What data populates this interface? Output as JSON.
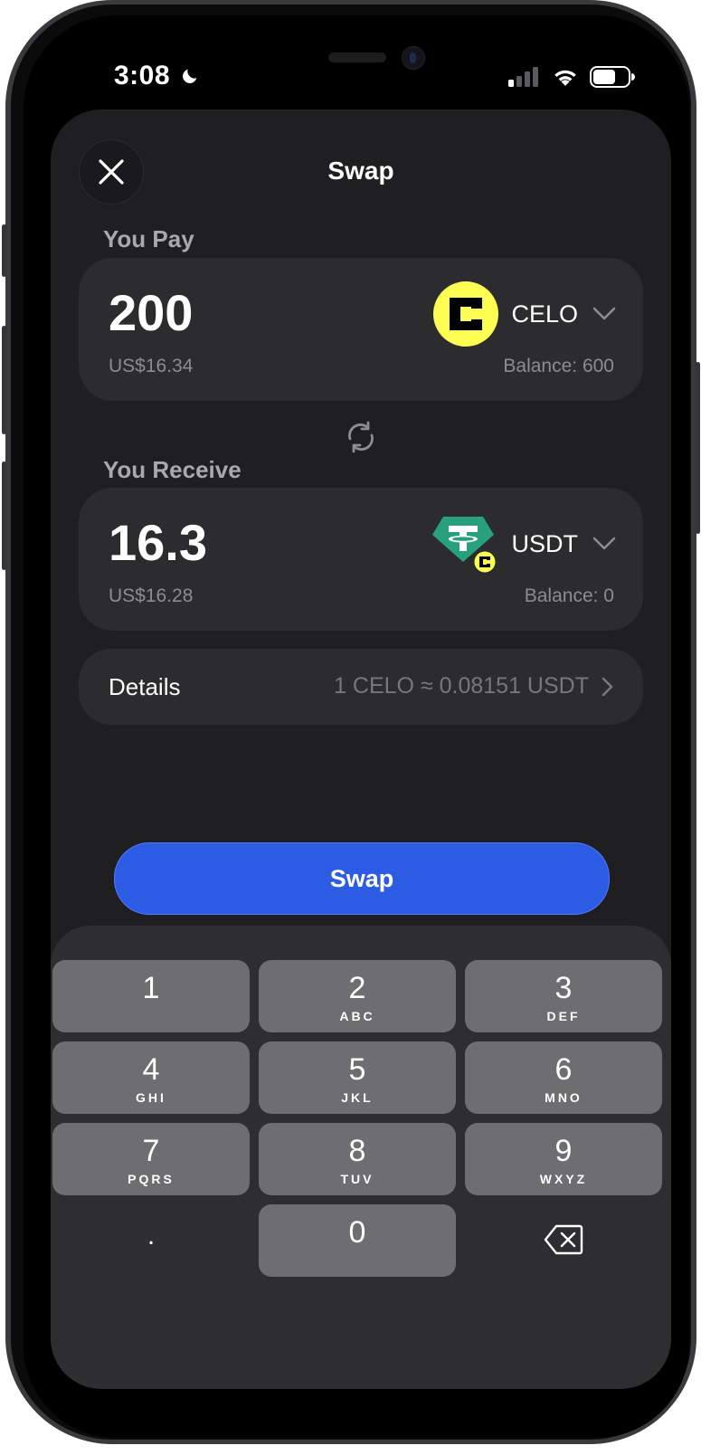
{
  "status_bar": {
    "time": "3:08"
  },
  "header": {
    "title": "Swap"
  },
  "pay": {
    "label": "You Pay",
    "amount": "200",
    "fiat_value": "US$16.34",
    "token": "CELO",
    "balance": "Balance: 600",
    "token_color": "#FCFF52"
  },
  "receive": {
    "label": "You Receive",
    "amount": "16.3",
    "fiat_value": "US$16.28",
    "token": "USDT",
    "balance": "Balance: 0",
    "token_color": "#26A17B"
  },
  "details": {
    "label": "Details",
    "rate": "1 CELO ≈ 0.08151 USDT"
  },
  "action": {
    "swap_label": "Swap",
    "accent": "#2C5CE3"
  },
  "keypad": {
    "keys": [
      {
        "digit": "1",
        "letters": ""
      },
      {
        "digit": "2",
        "letters": "ABC"
      },
      {
        "digit": "3",
        "letters": "DEF"
      },
      {
        "digit": "4",
        "letters": "GHI"
      },
      {
        "digit": "5",
        "letters": "JKL"
      },
      {
        "digit": "6",
        "letters": "MNO"
      },
      {
        "digit": "7",
        "letters": "PQRS"
      },
      {
        "digit": "8",
        "letters": "TUV"
      },
      {
        "digit": "9",
        "letters": "WXYZ"
      },
      {
        "digit": ".",
        "letters": ""
      },
      {
        "digit": "0",
        "letters": ""
      }
    ],
    "delete_icon": "backspace-icon"
  }
}
